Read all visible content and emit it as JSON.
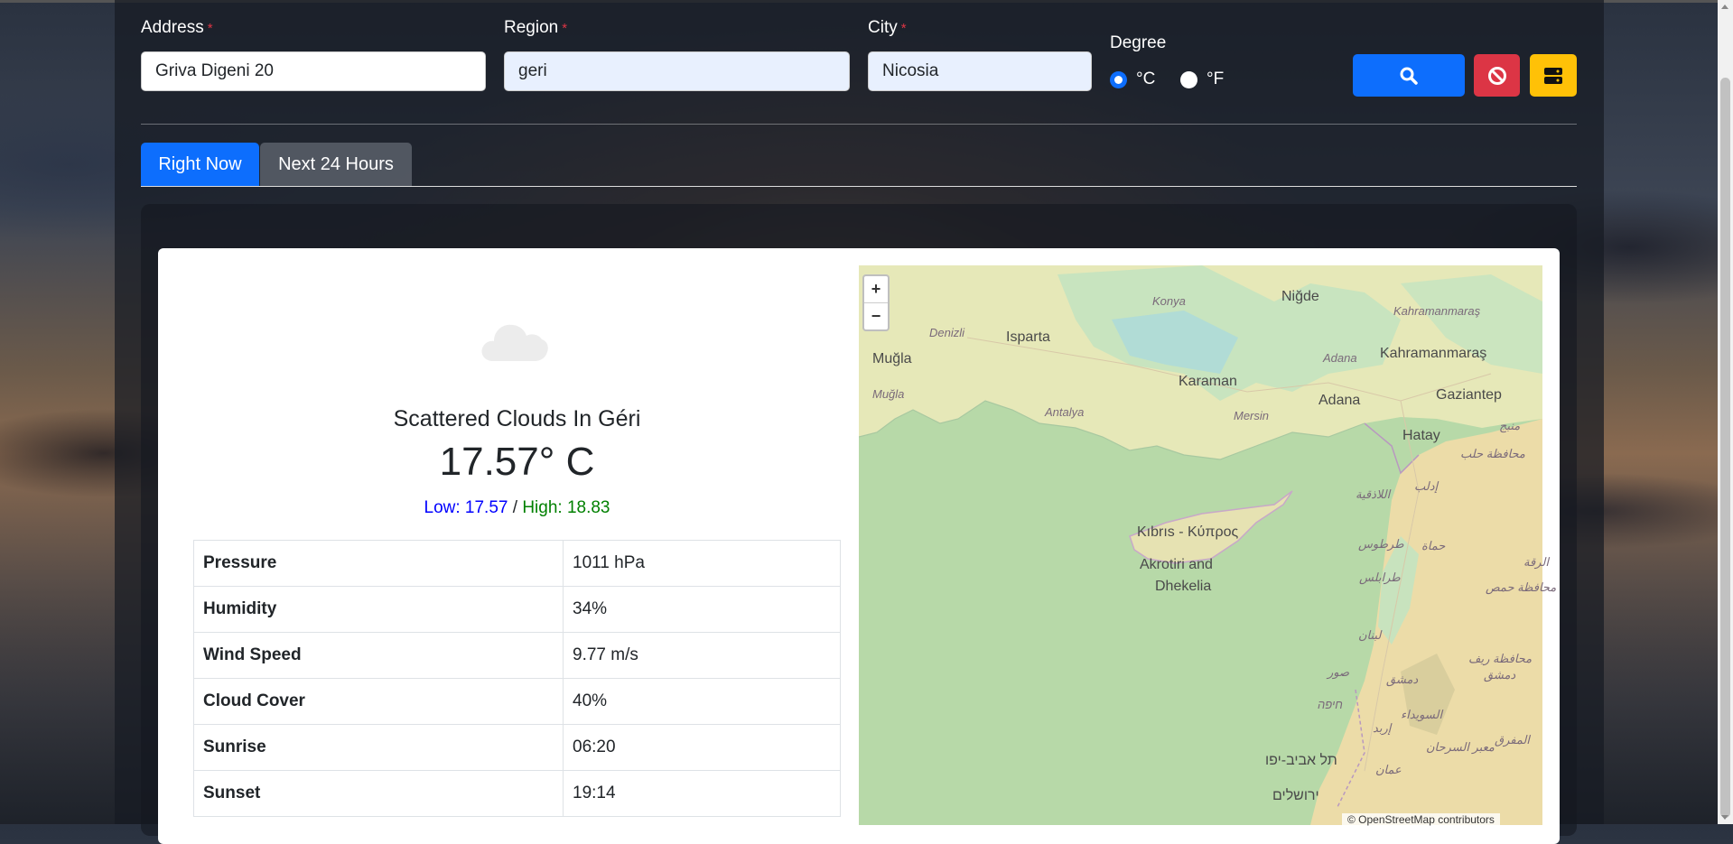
{
  "form": {
    "address": {
      "label": "Address",
      "required_mark": "*",
      "value": "Griva Digeni 20"
    },
    "region": {
      "label": "Region",
      "required_mark": "*",
      "value": "geri"
    },
    "city": {
      "label": "City",
      "required_mark": "*",
      "value": "Nicosia"
    },
    "degree": {
      "label": "Degree",
      "options": [
        "°C",
        "°F"
      ],
      "selected": "°C"
    },
    "buttons": {
      "search_icon": "search-icon",
      "clear_icon": "ban-icon",
      "save_icon": "server-icon"
    }
  },
  "tabs": [
    {
      "label": "Right Now",
      "active": true
    },
    {
      "label": "Next 24 Hours",
      "active": false
    }
  ],
  "weather": {
    "icon": "cloud-icon",
    "condition": "Scattered Clouds In Géri",
    "temperature": "17.57° C",
    "low_label": "Low: 17.57",
    "separator": "/",
    "high_label": "High: 18.83",
    "stats": [
      {
        "label": "Pressure",
        "value": "1011 hPa"
      },
      {
        "label": "Humidity",
        "value": "34%"
      },
      {
        "label": "Wind Speed",
        "value": "9.77 m/s"
      },
      {
        "label": "Cloud Cover",
        "value": "40%"
      },
      {
        "label": "Sunrise",
        "value": "06:20"
      },
      {
        "label": "Sunset",
        "value": "19:14"
      }
    ]
  },
  "map": {
    "zoom_in": "+",
    "zoom_out": "−",
    "attribution": "© OpenStreetMap contributors",
    "labels": {
      "konya": "Konya",
      "nigde": "Niğde",
      "isparta": "Isparta",
      "denizli": "Denizli",
      "mugla": "Muğla",
      "mugla2": "Muğla",
      "kahramanmaras": "Kahramanmaraş",
      "kahramanmaras2": "Kahramanmaraş",
      "adana": "Adana",
      "adana2": "Adana",
      "karaman": "Karaman",
      "gaziantep": "Gaziantep",
      "antalya": "Antalya",
      "mersin": "Mersin",
      "hatay": "Hatay",
      "kibris": "Kıbrıs - Κύπρος",
      "akrotiri": "Akrotiri and",
      "dhekelia": "Dhekelia",
      "halab": "محافظة حلب",
      "idlib": "إدلب",
      "latakia": "اللاذقية",
      "hama": "حماة",
      "tartus": "طرطوس",
      "tarabulus": "طرابلس",
      "homs": "محافظة حمص",
      "lubnan": "لبنان",
      "dimashq_rif": "محافظة ريف",
      "dimashq_rif2": "دمشق",
      "dimashq": "دمشق",
      "sur": "صور",
      "haifa": "חיפה",
      "suwayda": "السويداء",
      "irbid": "إربد",
      "mafraq": "المفرق",
      "telaviv": "תל אביב-יפו",
      "amman": "عمان",
      "jerusalem": "ירושלים",
      "sarhan": "معبر السرحان",
      "manbij": "منبج",
      "raqqa": "الرقة"
    }
  }
}
